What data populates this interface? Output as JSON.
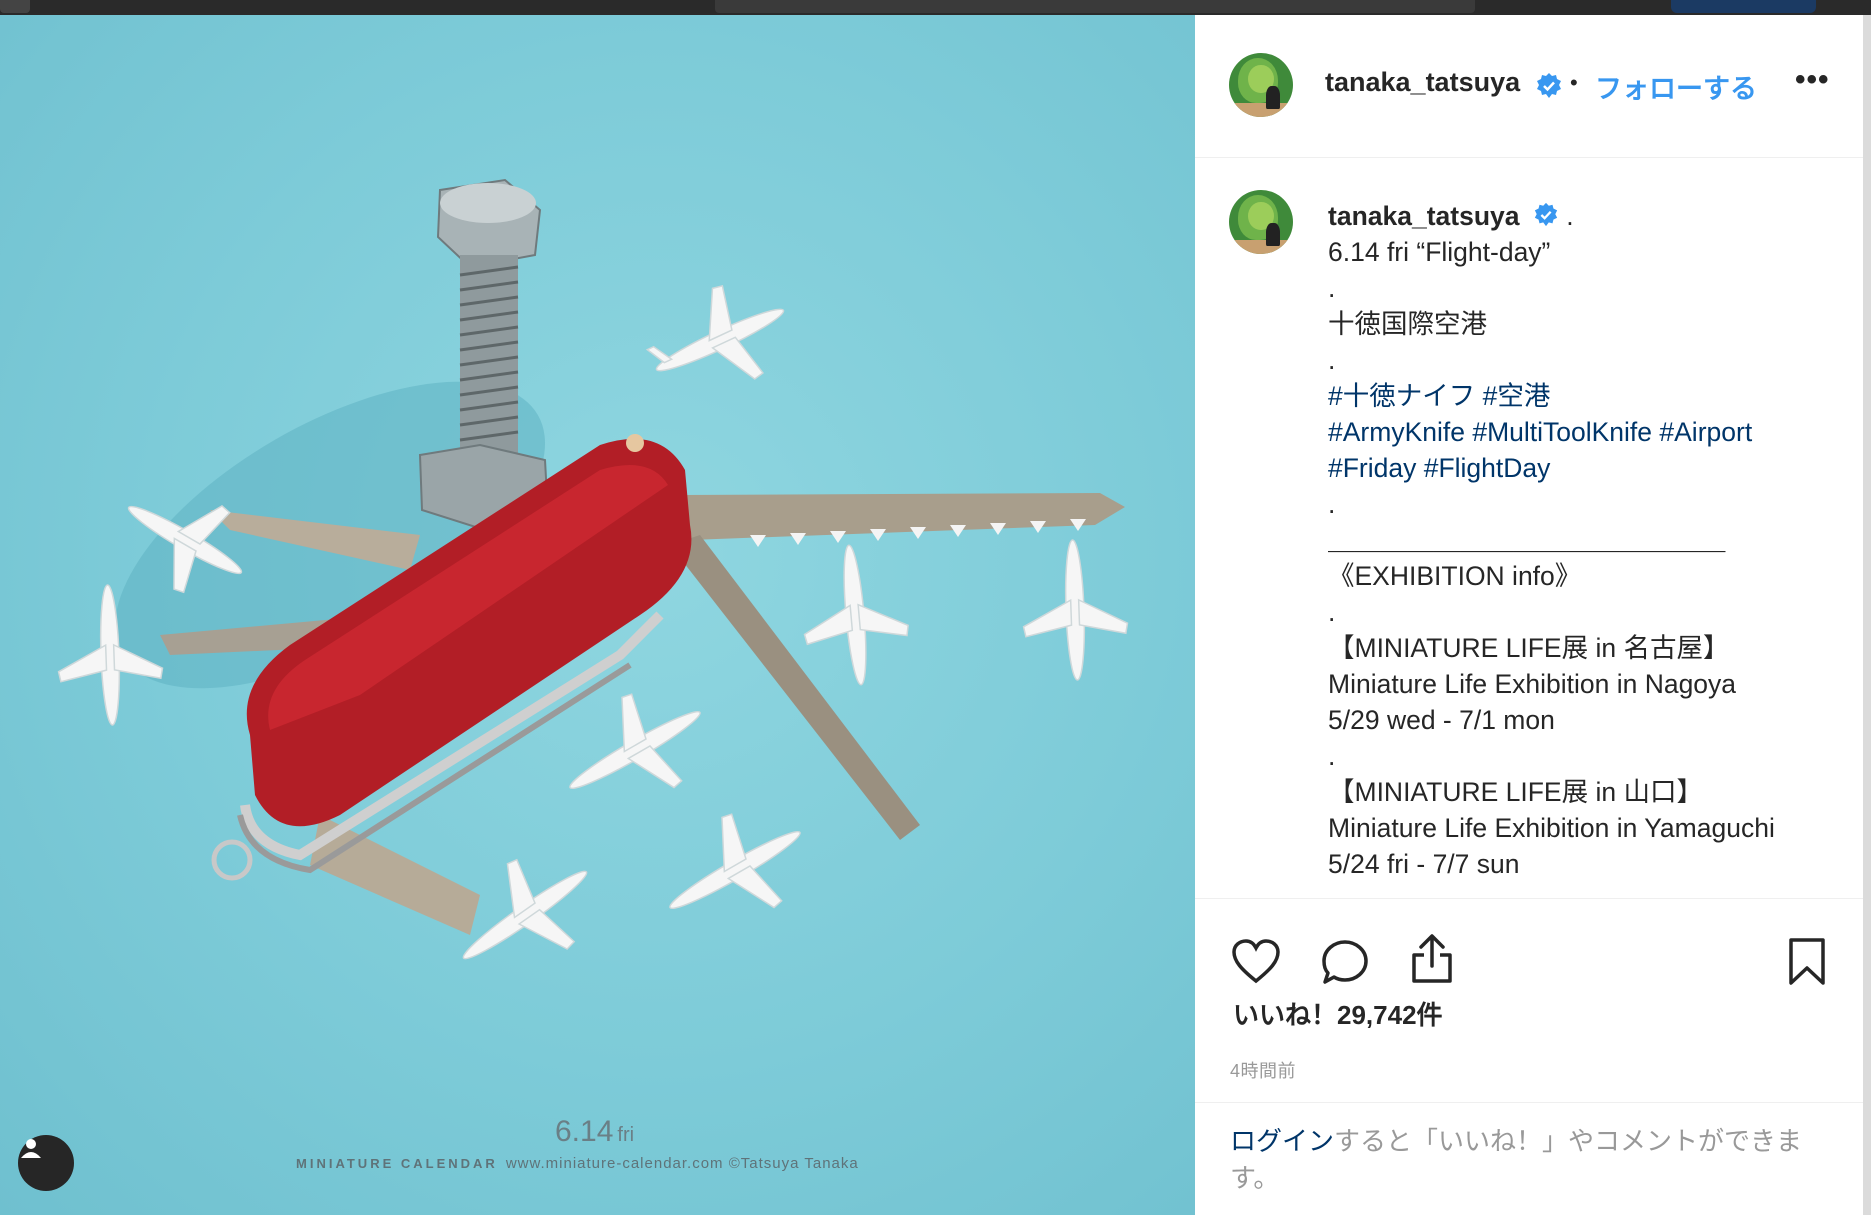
{
  "post": {
    "username": "tanaka_tatsuya",
    "follow_label": "フォローする",
    "more_label": "•••",
    "dot": "•"
  },
  "photo": {
    "date": "6.14",
    "date_suffix": "fri",
    "brand": "MINIATURE CALENDAR",
    "credit": "www.miniature-calendar.com ©Tatsuya Tanaka"
  },
  "caption": {
    "username": "tanaka_tatsuya",
    "lines": [
      {
        "text": "6.14 fri “Flight-day”",
        "type": "text"
      },
      {
        "text": ".",
        "type": "text"
      },
      {
        "text": "十徳国際空港",
        "type": "text"
      },
      {
        "text": ".",
        "type": "text"
      },
      {
        "text": "#十徳ナイフ #空港",
        "type": "tag"
      },
      {
        "text": "#ArmyKnife #MultiToolKnife #Airport",
        "type": "tag"
      },
      {
        "text": "#Friday #FlightDay",
        "type": "tag"
      },
      {
        "text": ".",
        "type": "text"
      },
      {
        "text": "＿＿＿＿＿＿＿＿＿＿＿＿＿＿＿",
        "type": "text"
      },
      {
        "text": "《EXHIBITION info》",
        "type": "text"
      },
      {
        "text": ".",
        "type": "text"
      },
      {
        "text": "【MINIATURE LIFE展 in 名古屋】",
        "type": "text"
      },
      {
        "text": "Miniature Life Exhibition in Nagoya",
        "type": "text"
      },
      {
        "text": "5/29 wed - 7/1 mon",
        "type": "text"
      },
      {
        "text": ".",
        "type": "text"
      },
      {
        "text": "【MINIATURE LIFE展 in 山口】",
        "type": "text"
      },
      {
        "text": "Miniature Life Exhibition in Yamaguchi",
        "type": "text"
      },
      {
        "text": "5/24 fri - 7/7 sun",
        "type": "text"
      }
    ]
  },
  "actions": {
    "like_icon": "heart-icon",
    "comment_icon": "comment-icon",
    "share_icon": "share-icon",
    "save_icon": "bookmark-icon"
  },
  "likes": "いいね！29,742件",
  "time_ago": "4時間前",
  "login_prompt": {
    "link": "ログイン",
    "rest": "すると「いいね！」やコメントができます。"
  },
  "colors": {
    "link_blue": "#3897f0",
    "hashtag": "#003569",
    "photo_bg": "#7dcbd8"
  }
}
